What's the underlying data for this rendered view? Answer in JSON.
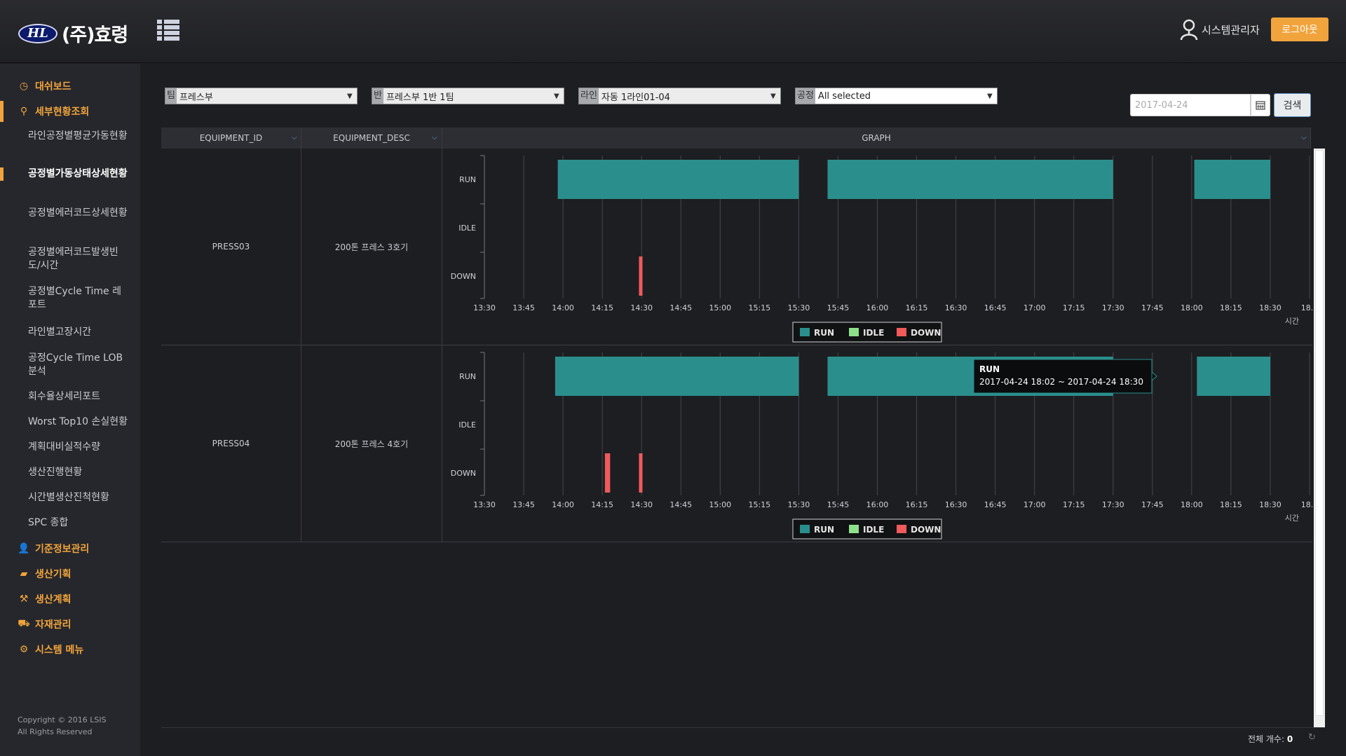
{
  "header": {
    "logo_mark": "HL",
    "logo_text": "(주)효령",
    "user_name": "시스템관리자",
    "logout_label": "로그아웃"
  },
  "sidebar": {
    "items": [
      {
        "icon": "dashboard-icon",
        "label": "대쉬보드"
      },
      {
        "icon": "search-icon",
        "label": "세부현황조회",
        "active": true
      },
      {
        "icon": "user-icon",
        "label": "기준정보관리"
      },
      {
        "icon": "folder-icon",
        "label": "생산기획"
      },
      {
        "icon": "wrench-icon",
        "label": "생산계획"
      },
      {
        "icon": "forklift-icon",
        "label": "자재관리"
      },
      {
        "icon": "gear-icon",
        "label": "시스템 메뉴"
      }
    ],
    "subitems": [
      "라인공정별평균가동현황",
      "공정별가동상태상세현황",
      "공정별에러코드상세현황",
      "공정별에러코드발생빈도/시간",
      "공정별Cycle Time 레포트",
      "라인별고장시간",
      "공정Cycle Time LOB 분석",
      "회수율상세리포트",
      "Worst Top10 손실현황",
      "계획대비실적수량",
      "생산진행현황",
      "시간별생산진척현황",
      "SPC 종합"
    ],
    "copyright_line1": "Copyright © 2016 LSIS",
    "copyright_line2": "All Rights Reserved"
  },
  "filters": {
    "team": {
      "tag": "팀",
      "value": "프레스부"
    },
    "group": {
      "tag": "반",
      "value": "프레스부 1반 1팀"
    },
    "line": {
      "tag": "라인",
      "value": "자동 1라인01-04"
    },
    "process": {
      "tag": "공정",
      "value": "All selected"
    },
    "date": "2017-04-24",
    "search_label": "검색"
  },
  "grid": {
    "columns": [
      "EQUIPMENT_ID",
      "EQUIPMENT_DESC",
      "GRAPH"
    ],
    "rows": [
      {
        "equipment_id": "PRESS03",
        "equipment_desc": "200톤 프레스 3호기"
      },
      {
        "equipment_id": "PRESS04",
        "equipment_desc": "200톤 프레스 4호기"
      }
    ],
    "total_label": "전체 개수:",
    "total_count": "0"
  },
  "chart_data": [
    {
      "type": "timeline",
      "equipment": "PRESS03",
      "y_categories": [
        "RUN",
        "IDLE",
        "DOWN"
      ],
      "x_ticks": [
        "13:30",
        "13:45",
        "14:00",
        "14:15",
        "14:30",
        "14:45",
        "15:00",
        "15:15",
        "15:30",
        "15:45",
        "16:00",
        "16:15",
        "16:30",
        "16:45",
        "17:00",
        "17:15",
        "17:30",
        "17:45",
        "18:00",
        "18:15",
        "18:30",
        "18..."
      ],
      "x_range": [
        "13:30",
        "18:45"
      ],
      "xlabel": "시간",
      "legend": [
        "RUN",
        "IDLE",
        "DOWN"
      ],
      "colors": {
        "RUN": "#2a8f8c",
        "IDLE": "#8fe08a",
        "DOWN": "#f05a5a"
      },
      "segments": [
        {
          "state": "RUN",
          "start": "13:58",
          "end": "15:30"
        },
        {
          "state": "RUN",
          "start": "15:41",
          "end": "17:30"
        },
        {
          "state": "RUN",
          "start": "18:01",
          "end": "18:30"
        },
        {
          "state": "DOWN",
          "start": "14:29",
          "end": "14:30"
        }
      ]
    },
    {
      "type": "timeline",
      "equipment": "PRESS04",
      "y_categories": [
        "RUN",
        "IDLE",
        "DOWN"
      ],
      "x_ticks": [
        "13:30",
        "13:45",
        "14:00",
        "14:15",
        "14:30",
        "14:45",
        "15:00",
        "15:15",
        "15:30",
        "15:45",
        "16:00",
        "16:15",
        "16:30",
        "16:45",
        "17:00",
        "17:15",
        "17:30",
        "17:45",
        "18:00",
        "18:15",
        "18:30",
        "18..."
      ],
      "x_range": [
        "13:30",
        "18:45"
      ],
      "xlabel": "시간",
      "legend": [
        "RUN",
        "IDLE",
        "DOWN"
      ],
      "colors": {
        "RUN": "#2a8f8c",
        "IDLE": "#8fe08a",
        "DOWN": "#f05a5a"
      },
      "segments": [
        {
          "state": "RUN",
          "start": "13:57",
          "end": "15:30"
        },
        {
          "state": "RUN",
          "start": "15:41",
          "end": "17:30"
        },
        {
          "state": "RUN",
          "start": "18:02",
          "end": "18:30"
        },
        {
          "state": "DOWN",
          "start": "14:16",
          "end": "14:18"
        },
        {
          "state": "DOWN",
          "start": "14:29",
          "end": "14:30"
        }
      ],
      "tooltip": {
        "title": "RUN",
        "text": "2017-04-24 18:02 ~ 2017-04-24 18:30"
      }
    }
  ]
}
